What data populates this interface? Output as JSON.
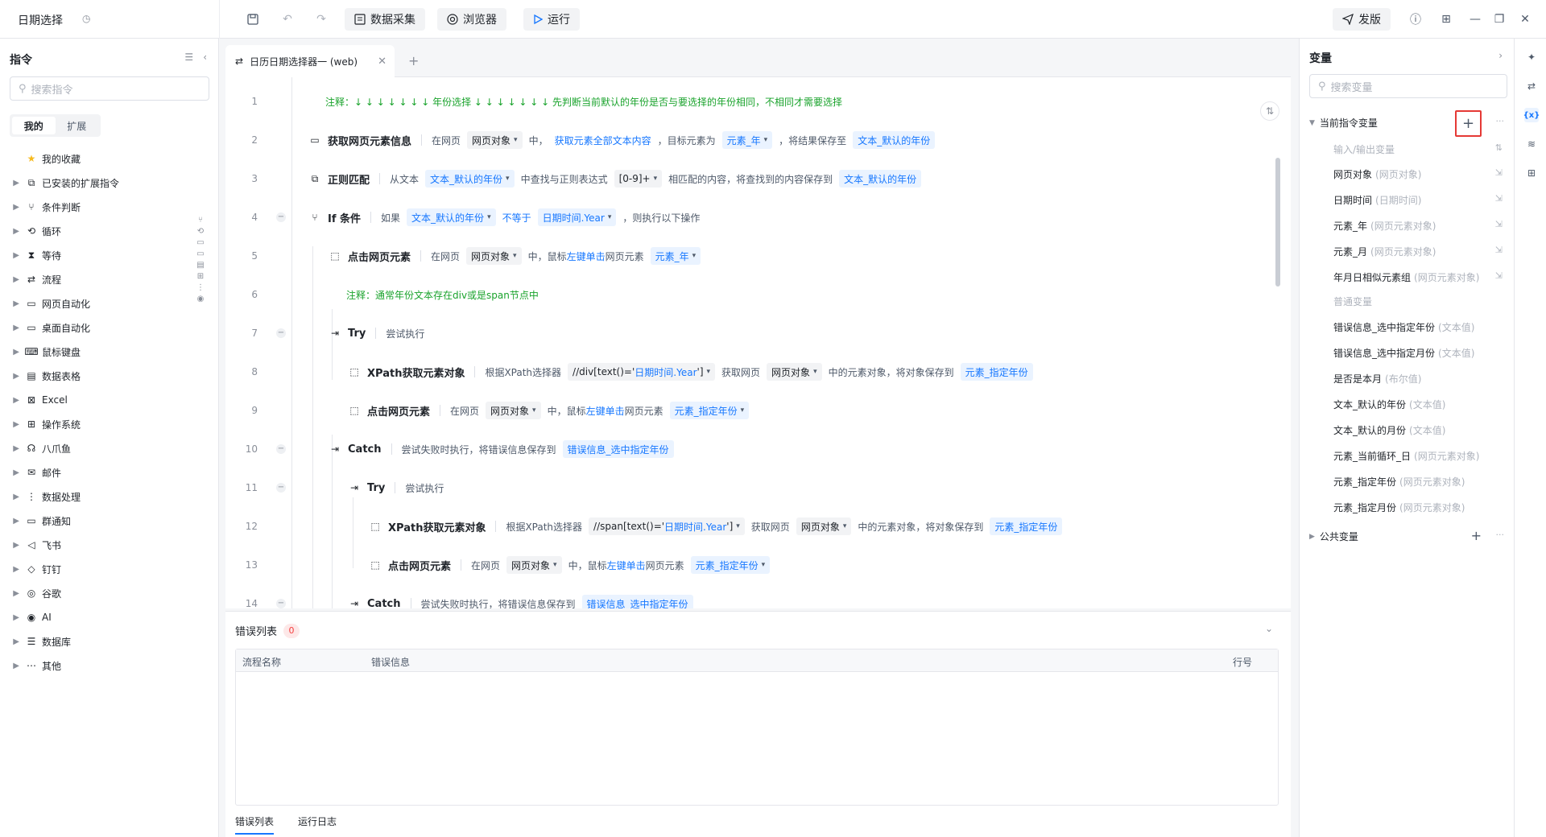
{
  "app": {
    "title": "日期选择"
  },
  "toolbar": {
    "data_collect": "数据采集",
    "browser": "浏览器",
    "run": "运行",
    "publish": "发版"
  },
  "left": {
    "title": "指令",
    "search_placeholder": "搜索指令",
    "tabs": [
      "我的",
      "扩展"
    ],
    "items": [
      {
        "label": "我的收藏",
        "icon": "star-icon"
      },
      {
        "label": "已安装的扩展指令",
        "icon": "extension-icon"
      },
      {
        "label": "条件判断",
        "icon": "branch-icon"
      },
      {
        "label": "循环",
        "icon": "loop-icon"
      },
      {
        "label": "等待",
        "icon": "hourglass-icon"
      },
      {
        "label": "流程",
        "icon": "flow-icon"
      },
      {
        "label": "网页自动化",
        "icon": "web-icon"
      },
      {
        "label": "桌面自动化",
        "icon": "desktop-icon"
      },
      {
        "label": "鼠标键盘",
        "icon": "keyboard-icon"
      },
      {
        "label": "数据表格",
        "icon": "table-icon"
      },
      {
        "label": "Excel",
        "icon": "excel-icon"
      },
      {
        "label": "操作系统",
        "icon": "os-icon"
      },
      {
        "label": "八爪鱼",
        "icon": "octopus-icon"
      },
      {
        "label": "邮件",
        "icon": "mail-icon"
      },
      {
        "label": "数据处理",
        "icon": "data-process-icon"
      },
      {
        "label": "群通知",
        "icon": "group-notice-icon"
      },
      {
        "label": "飞书",
        "icon": "feishu-icon"
      },
      {
        "label": "钉钉",
        "icon": "dingtalk-icon"
      },
      {
        "label": "谷歌",
        "icon": "google-icon"
      },
      {
        "label": "AI",
        "icon": "ai-icon"
      },
      {
        "label": "数据库",
        "icon": "database-icon"
      },
      {
        "label": "其他",
        "icon": "more-icon"
      }
    ]
  },
  "editor": {
    "tab_label": "日历日期选择器一 (web)",
    "lines": {
      "l1": {
        "num": "1",
        "comment": "注释：↓ ↓ ↓ ↓ ↓ ↓ ↓  年份选择  ↓ ↓ ↓ ↓ ↓ ↓ ↓  先判断当前默认的年份是否与要选择的年份相同，不相同才需要选择"
      },
      "l2": {
        "num": "2",
        "name": "获取网页元素信息",
        "t1": "在网页",
        "p1": "网页对象",
        "t2": "中，",
        "link": "获取元素全部文本内容",
        "t3": "，目标元素为",
        "p2": "元素_年",
        "t4": "，将结果保存至",
        "p3": "文本_默认的年份"
      },
      "l3": {
        "num": "3",
        "name": "正则匹配",
        "t1": "从文本",
        "p1": "文本_默认的年份",
        "t2": "中查找与正则表达式",
        "p2": "[0-9]+",
        "t3": "相匹配的内容，将查找到的内容保存到",
        "p3": "文本_默认的年份"
      },
      "l4": {
        "num": "4",
        "name": "If 条件",
        "t1": "如果",
        "p1": "文本_默认的年份",
        "op": "不等于",
        "p2": "日期时间.Year",
        "t2": "，则执行以下操作"
      },
      "l5": {
        "num": "5",
        "name": "点击网页元素",
        "t1": "在网页",
        "p1": "网页对象",
        "t2": "中，鼠标",
        "link": "左键单击",
        "t3": "网页元素",
        "p2": "元素_年"
      },
      "l6": {
        "num": "6",
        "comment": "注释：通常年份文本存在div或是span节点中"
      },
      "l7": {
        "num": "7",
        "name": "Try",
        "t1": "尝试执行"
      },
      "l8": {
        "num": "8",
        "name": "XPath获取元素对象",
        "t1": "根据XPath选择器",
        "xp_a": "//div[text()='",
        "xp_b": "日期时间.Year",
        "xp_c": "']",
        "t2": "获取网页",
        "p1": "网页对象",
        "t3": "中的元素对象，将对象保存到",
        "p2": "元素_指定年份"
      },
      "l9": {
        "num": "9",
        "name": "点击网页元素",
        "t1": "在网页",
        "p1": "网页对象",
        "t2": "中，鼠标",
        "link": "左键单击",
        "t3": "网页元素",
        "p2": "元素_指定年份"
      },
      "l10": {
        "num": "10",
        "name": "Catch",
        "t1": "尝试失败时执行，将错误信息保存到",
        "p1": "错误信息_选中指定年份"
      },
      "l11": {
        "num": "11",
        "name": "Try",
        "t1": "尝试执行"
      },
      "l12": {
        "num": "12",
        "name": "XPath获取元素对象",
        "t1": "根据XPath选择器",
        "xp_a": "//span[text()='",
        "xp_b": "日期时间.Year",
        "xp_c": "']",
        "t2": "获取网页",
        "p1": "网页对象",
        "t3": "中的元素对象，将对象保存到",
        "p2": "元素_指定年份"
      },
      "l13": {
        "num": "13",
        "name": "点击网页元素",
        "t1": "在网页",
        "p1": "网页对象",
        "t2": "中，鼠标",
        "link": "左键单击",
        "t3": "网页元素",
        "p2": "元素_指定年份"
      },
      "l14": {
        "num": "14",
        "name": "Catch",
        "t1": "尝试失败时执行，将错误信息保存到",
        "p1": "错误信息_选中指定年份"
      }
    }
  },
  "errors": {
    "title": "错误列表",
    "count": "0",
    "col_flow": "流程名称",
    "col_msg": "错误信息",
    "col_line": "行号",
    "tab_errors": "错误列表",
    "tab_log": "运行日志"
  },
  "vars": {
    "title": "变量",
    "search_placeholder": "搜索变量",
    "current_group": "当前指令变量",
    "io_label": "输入/输出变量",
    "io_vars": [
      {
        "name": "网页对象",
        "type": "(网页对象)"
      },
      {
        "name": "日期时间",
        "type": "(日期时间)"
      },
      {
        "name": "元素_年",
        "type": "(网页元素对象)"
      },
      {
        "name": "元素_月",
        "type": "(网页元素对象)"
      },
      {
        "name": "年月日相似元素组",
        "type": "(网页元素对象)"
      }
    ],
    "normal_label": "普通变量",
    "normal_vars": [
      {
        "name": "错误信息_选中指定年份",
        "type": "(文本值)"
      },
      {
        "name": "错误信息_选中指定月份",
        "type": "(文本值)"
      },
      {
        "name": "是否是本月",
        "type": "(布尔值)"
      },
      {
        "name": "文本_默认的年份",
        "type": "(文本值)"
      },
      {
        "name": "文本_默认的月份",
        "type": "(文本值)"
      },
      {
        "name": "元素_当前循环_日",
        "type": "(网页元素对象)"
      },
      {
        "name": "元素_指定年份",
        "type": "(网页元素对象)"
      },
      {
        "name": "元素_指定月份",
        "type": "(网页元素对象)"
      }
    ],
    "public_group": "公共变量"
  }
}
